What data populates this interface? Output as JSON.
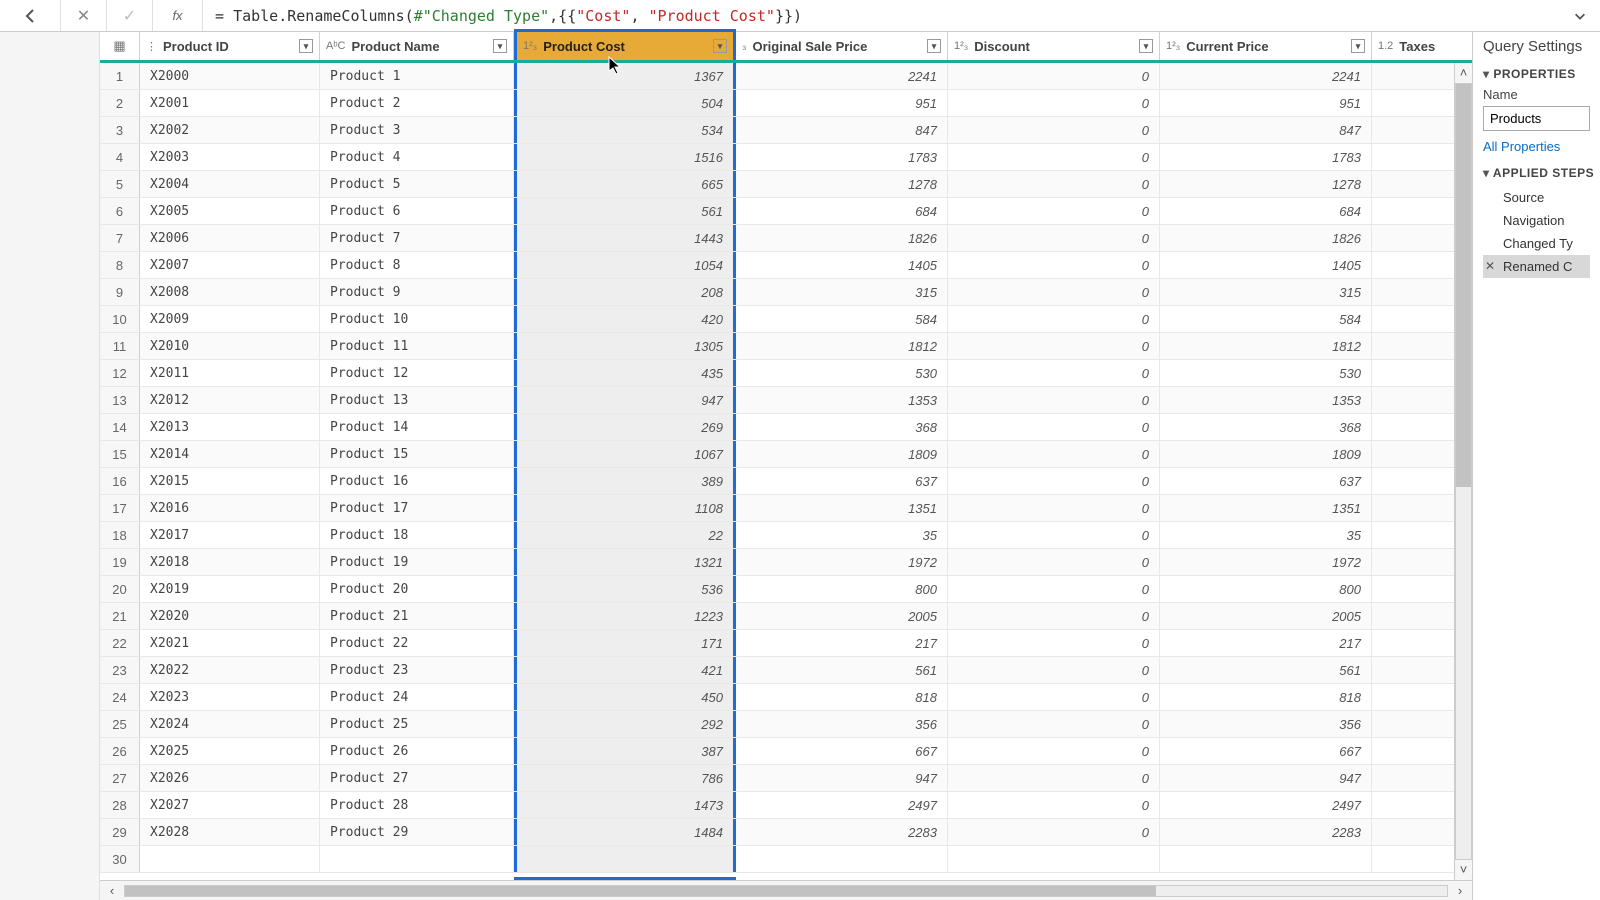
{
  "formula_bar": {
    "fx_label": "fx",
    "text_prefix": "= ",
    "fn": "Table.RenameColumns",
    "open": "(",
    "ref": "#\"Changed Type\"",
    "mid": ",{{",
    "str1": "\"Cost\"",
    "sep": ", ",
    "str2": "\"Product Cost\"",
    "close": "}})"
  },
  "columns": {
    "row_icon": "▦",
    "product_id": {
      "type": "⋮",
      "label": "Product ID"
    },
    "product_name": {
      "type": "AᵇC",
      "label": "Product Name"
    },
    "product_cost": {
      "type": "1²₃",
      "label": "Product Cost"
    },
    "orig_price": {
      "type": "₃",
      "label": "Original Sale Price"
    },
    "discount": {
      "type": "1²₃",
      "label": "Discount"
    },
    "current": {
      "type": "1²₃",
      "label": "Current Price"
    },
    "taxes": {
      "type": "1.2",
      "label": "Taxes"
    }
  },
  "rows": [
    {
      "n": 1,
      "id": "X2000",
      "name": "Product 1",
      "cost": 1367,
      "orig": 2241,
      "disc": 0,
      "curr": 2241
    },
    {
      "n": 2,
      "id": "X2001",
      "name": "Product 2",
      "cost": 504,
      "orig": 951,
      "disc": 0,
      "curr": 951
    },
    {
      "n": 3,
      "id": "X2002",
      "name": "Product 3",
      "cost": 534,
      "orig": 847,
      "disc": 0,
      "curr": 847
    },
    {
      "n": 4,
      "id": "X2003",
      "name": "Product 4",
      "cost": 1516,
      "orig": 1783,
      "disc": 0,
      "curr": 1783
    },
    {
      "n": 5,
      "id": "X2004",
      "name": "Product 5",
      "cost": 665,
      "orig": 1278,
      "disc": 0,
      "curr": 1278
    },
    {
      "n": 6,
      "id": "X2005",
      "name": "Product 6",
      "cost": 561,
      "orig": 684,
      "disc": 0,
      "curr": 684
    },
    {
      "n": 7,
      "id": "X2006",
      "name": "Product 7",
      "cost": 1443,
      "orig": 1826,
      "disc": 0,
      "curr": 1826
    },
    {
      "n": 8,
      "id": "X2007",
      "name": "Product 8",
      "cost": 1054,
      "orig": 1405,
      "disc": 0,
      "curr": 1405
    },
    {
      "n": 9,
      "id": "X2008",
      "name": "Product 9",
      "cost": 208,
      "orig": 315,
      "disc": 0,
      "curr": 315
    },
    {
      "n": 10,
      "id": "X2009",
      "name": "Product 10",
      "cost": 420,
      "orig": 584,
      "disc": 0,
      "curr": 584
    },
    {
      "n": 11,
      "id": "X2010",
      "name": "Product 11",
      "cost": 1305,
      "orig": 1812,
      "disc": 0,
      "curr": 1812
    },
    {
      "n": 12,
      "id": "X2011",
      "name": "Product 12",
      "cost": 435,
      "orig": 530,
      "disc": 0,
      "curr": 530
    },
    {
      "n": 13,
      "id": "X2012",
      "name": "Product 13",
      "cost": 947,
      "orig": 1353,
      "disc": 0,
      "curr": 1353
    },
    {
      "n": 14,
      "id": "X2013",
      "name": "Product 14",
      "cost": 269,
      "orig": 368,
      "disc": 0,
      "curr": 368
    },
    {
      "n": 15,
      "id": "X2014",
      "name": "Product 15",
      "cost": 1067,
      "orig": 1809,
      "disc": 0,
      "curr": 1809
    },
    {
      "n": 16,
      "id": "X2015",
      "name": "Product 16",
      "cost": 389,
      "orig": 637,
      "disc": 0,
      "curr": 637
    },
    {
      "n": 17,
      "id": "X2016",
      "name": "Product 17",
      "cost": 1108,
      "orig": 1351,
      "disc": 0,
      "curr": 1351
    },
    {
      "n": 18,
      "id": "X2017",
      "name": "Product 18",
      "cost": 22,
      "orig": 35,
      "disc": 0,
      "curr": 35
    },
    {
      "n": 19,
      "id": "X2018",
      "name": "Product 19",
      "cost": 1321,
      "orig": 1972,
      "disc": 0,
      "curr": 1972
    },
    {
      "n": 20,
      "id": "X2019",
      "name": "Product 20",
      "cost": 536,
      "orig": 800,
      "disc": 0,
      "curr": 800
    },
    {
      "n": 21,
      "id": "X2020",
      "name": "Product 21",
      "cost": 1223,
      "orig": 2005,
      "disc": 0,
      "curr": 2005
    },
    {
      "n": 22,
      "id": "X2021",
      "name": "Product 22",
      "cost": 171,
      "orig": 217,
      "disc": 0,
      "curr": 217
    },
    {
      "n": 23,
      "id": "X2022",
      "name": "Product 23",
      "cost": 421,
      "orig": 561,
      "disc": 0,
      "curr": 561
    },
    {
      "n": 24,
      "id": "X2023",
      "name": "Product 24",
      "cost": 450,
      "orig": 818,
      "disc": 0,
      "curr": 818
    },
    {
      "n": 25,
      "id": "X2024",
      "name": "Product 25",
      "cost": 292,
      "orig": 356,
      "disc": 0,
      "curr": 356
    },
    {
      "n": 26,
      "id": "X2025",
      "name": "Product 26",
      "cost": 387,
      "orig": 667,
      "disc": 0,
      "curr": 667
    },
    {
      "n": 27,
      "id": "X2026",
      "name": "Product 27",
      "cost": 786,
      "orig": 947,
      "disc": 0,
      "curr": 947
    },
    {
      "n": 28,
      "id": "X2027",
      "name": "Product 28",
      "cost": 1473,
      "orig": 2497,
      "disc": 0,
      "curr": 2497
    },
    {
      "n": 29,
      "id": "X2028",
      "name": "Product 29",
      "cost": 1484,
      "orig": 2283,
      "disc": 0,
      "curr": 2283
    },
    {
      "n": 30,
      "id": "",
      "name": "",
      "cost": "",
      "orig": "",
      "disc": "",
      "curr": ""
    }
  ],
  "settings": {
    "title": "Query Settings",
    "properties_hdr": "PROPERTIES",
    "name_label": "Name",
    "name_value": "Products",
    "all_props": "All Properties",
    "steps_hdr": "APPLIED STEPS",
    "steps": [
      "Source",
      "Navigation",
      "Changed Ty",
      "Renamed C"
    ],
    "selected_step": 3
  }
}
